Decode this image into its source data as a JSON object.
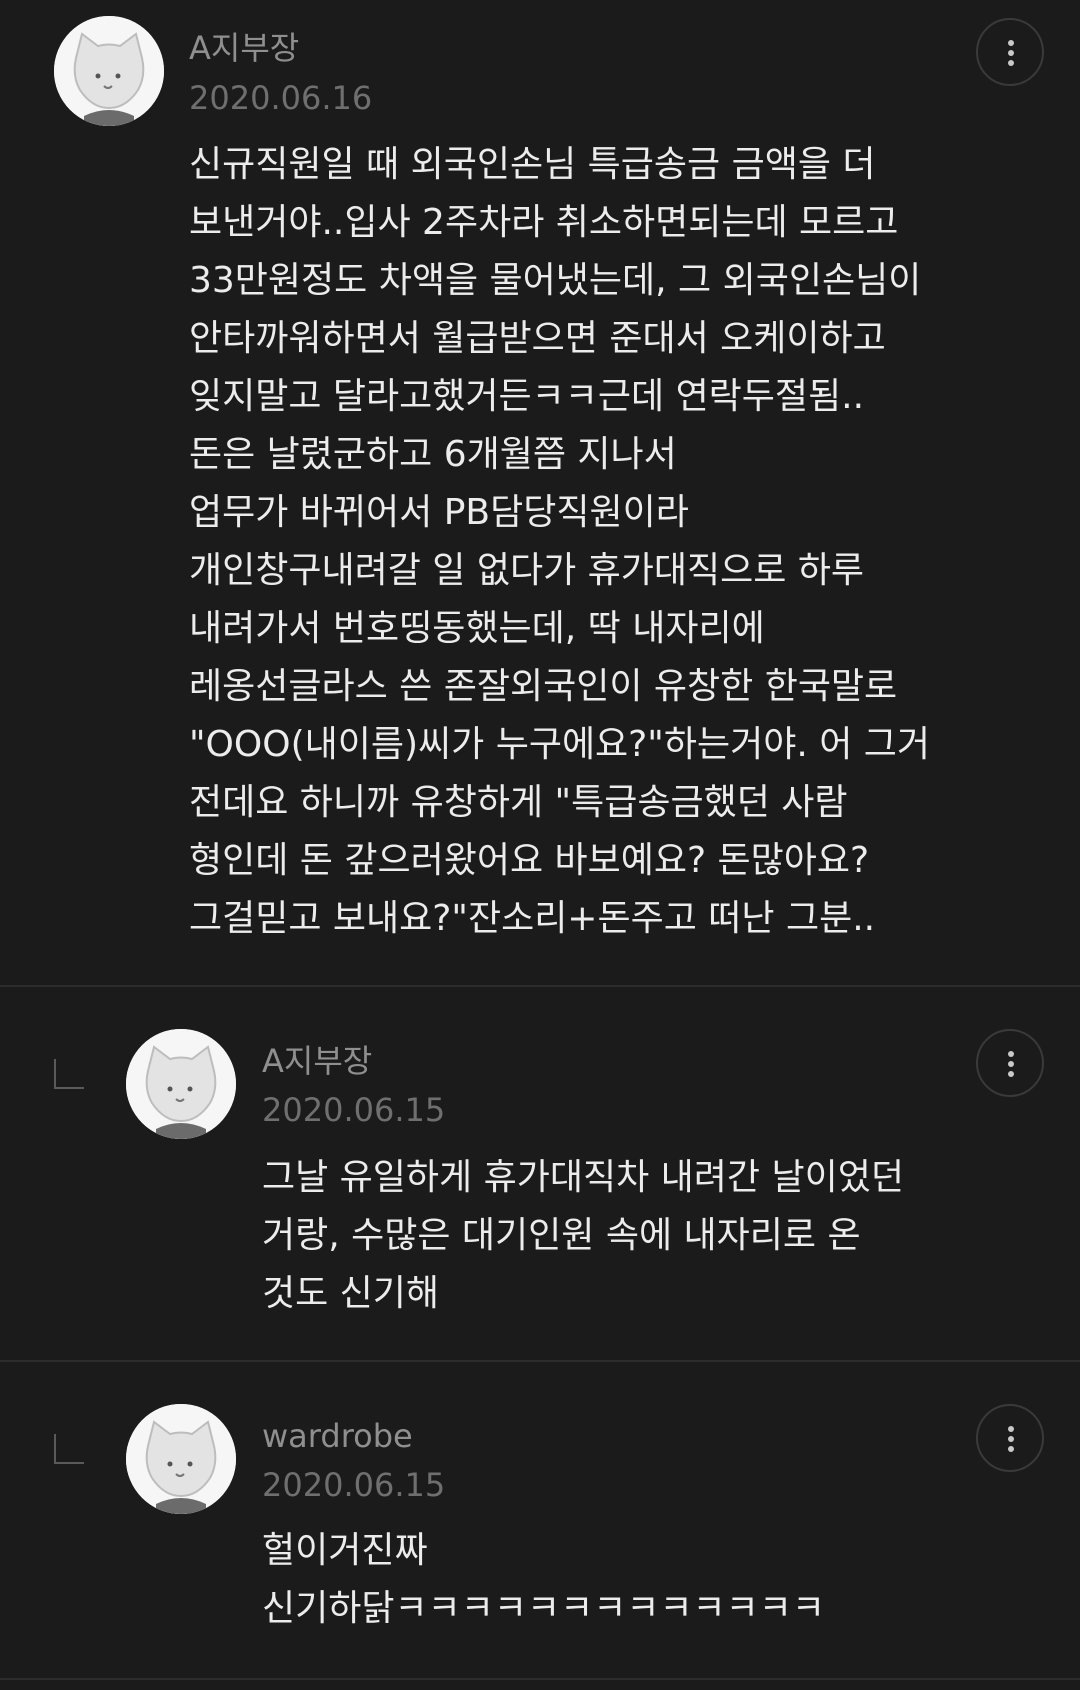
{
  "comments": [
    {
      "author": "A지부장",
      "date": "2020.06.16",
      "is_reply": false,
      "lines": [
        "신규직원일 때 외국인손님 특급송금 금액을 더",
        "보낸거야..입사 2주차라 취소하면되는데 모르고",
        "33만원정도 차액을 물어냈는데, 그 외국인손님이",
        "안타까워하면서 월급받으면 준대서 오케이하고",
        "잊지말고 달라고했거든ㅋㅋ근데 연락두절됨..",
        "돈은 날렸군하고 6개월쯤 지나서",
        "업무가 바뀌어서 PB담당직원이라",
        "개인창구내려갈 일 없다가 휴가대직으로 하루",
        "내려가서 번호띵동했는데, 딱 내자리에",
        "레옹선글라스 쓴 존잘외국인이 유창한 한국말로",
        "\"OOO(내이름)씨가 누구에요?\"하는거야. 어 그거",
        "전데요 하니까 유창하게 \"특급송금했던 사람",
        "형인데 돈 갚으러왔어요 바보예요? 돈많아요?",
        "그걸믿고 보내요?\"잔소리+돈주고 떠난 그분.."
      ]
    },
    {
      "author": "A지부장",
      "date": "2020.06.15",
      "is_reply": true,
      "lines": [
        "그날 유일하게 휴가대직차 내려간 날이었던",
        "거랑, 수많은 대기인원 속에 내자리로 온",
        "것도 신기해"
      ]
    },
    {
      "author": "wardrobe",
      "date": "2020.06.15",
      "is_reply": true,
      "lines": [
        "헐이거진짜",
        "신기하닭ㅋㅋㅋㅋㅋㅋㅋㅋㅋㅋㅋㅋㅋ"
      ]
    }
  ],
  "icons": {
    "avatar": "cat-avatar-icon",
    "more": "more-vertical-icon",
    "reply": "reply-arrow-icon"
  },
  "colors": {
    "background": "#1b1b1b",
    "text": "#ececec",
    "author": "#8f8f8f",
    "date": "#6f6f6f",
    "divider": "#2c2c2c"
  }
}
